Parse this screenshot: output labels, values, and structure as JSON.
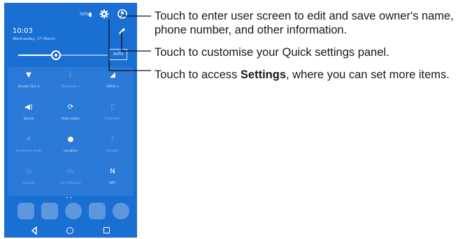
{
  "phone": {
    "status": {
      "battery_text": "56%"
    },
    "time": "10:03",
    "date": "Wednesday, 27 March",
    "brightness": {
      "level": 0.42,
      "auto_label": "AUTO"
    },
    "tiles": [
      {
        "label": "Alcatel 5G1 ▾",
        "icon": "wifi-icon",
        "glyph": "▼",
        "active": true
      },
      {
        "label": "Bluetooth ▾",
        "icon": "bluetooth-icon",
        "glyph": "ᛒ",
        "active": false
      },
      {
        "label": "SMOC ▾",
        "icon": "signal-icon",
        "glyph": "◢",
        "active": true
      },
      {
        "label": "Sound",
        "icon": "volume-icon",
        "glyph": "◀)",
        "active": true
      },
      {
        "label": "Auto-rotate",
        "icon": "rotate-icon",
        "glyph": "⟳",
        "active": true
      },
      {
        "label": "Flashlight",
        "icon": "flashlight-icon",
        "glyph": "▯",
        "active": false
      },
      {
        "label": "Aeroplane mode",
        "icon": "airplane-icon",
        "glyph": "✈",
        "active": false
      },
      {
        "label": "Location",
        "icon": "location-icon",
        "glyph": "●",
        "active": true
      },
      {
        "label": "Hotspot",
        "icon": "hotspot-icon",
        "glyph": "⫯",
        "active": false
      },
      {
        "label": "Hotspot",
        "icon": "hotspot2-icon",
        "glyph": "◎",
        "active": false
      },
      {
        "label": "Wi-Fi Display",
        "icon": "cast-icon",
        "glyph": "▭",
        "active": false
      },
      {
        "label": "NFC",
        "icon": "nfc-icon",
        "glyph": "N",
        "active": true
      }
    ]
  },
  "callouts": {
    "user": "Touch to enter user screen to edit and save owner's name, phone number, and other information.",
    "customise": "Touch to customise your Quick settings panel.",
    "settings_before": "Touch to access ",
    "settings_bold": "Settings",
    "settings_after": ", where you can set more items."
  },
  "colors": {
    "phone_bg": "#1a6fd2",
    "tile_panel": "#2c7ad8",
    "text": "#1a1a1a"
  }
}
